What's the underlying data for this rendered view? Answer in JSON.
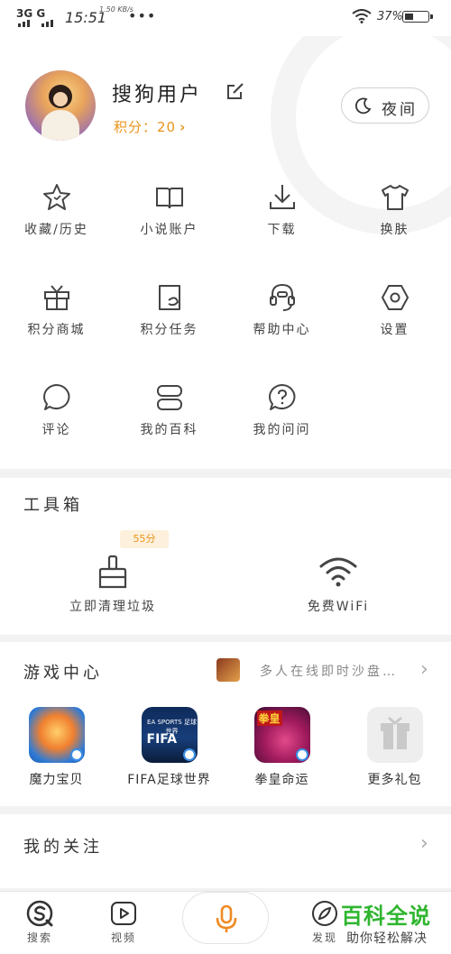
{
  "status_bar": {
    "signal": "3G G",
    "time": "15:51",
    "net_speed": "1.50 KB/s",
    "more": "•••",
    "battery_percent": "37%",
    "battery_level": 0.37
  },
  "profile": {
    "username": "搜狗用户",
    "points_label": "积分：20",
    "night_mode_label": "夜间"
  },
  "grid": [
    {
      "label": "收藏/历史",
      "icon": "star-icon"
    },
    {
      "label": "小说账户",
      "icon": "book-icon"
    },
    {
      "label": "下载",
      "icon": "download-icon"
    },
    {
      "label": "换肤",
      "icon": "tshirt-icon"
    },
    {
      "label": "积分商城",
      "icon": "gift-icon"
    },
    {
      "label": "积分任务",
      "icon": "task-icon"
    },
    {
      "label": "帮助中心",
      "icon": "headset-icon"
    },
    {
      "label": "设置",
      "icon": "settings-icon"
    },
    {
      "label": "评论",
      "icon": "comment-icon"
    },
    {
      "label": "我的百科",
      "icon": "encyclopedia-icon"
    },
    {
      "label": "我的问问",
      "icon": "question-icon"
    }
  ],
  "toolbox": {
    "title": "工具箱",
    "items": [
      {
        "label": "立即清理垃圾",
        "badge": "55分",
        "icon": "broom-icon"
      },
      {
        "label": "免费WiFi",
        "icon": "wifi-icon"
      }
    ]
  },
  "game_center": {
    "title": "游戏中心",
    "promo_text": "多人在线即时沙盘…",
    "games": [
      {
        "label": "魔力宝贝"
      },
      {
        "label": "FIFA足球世界",
        "icon_text": "FIFA",
        "icon_subtext": "EA SPORTS 足球世界"
      },
      {
        "label": "拳皇命运",
        "icon_text": "拳皇"
      },
      {
        "label": "更多礼包"
      }
    ]
  },
  "follow": {
    "title": "我的关注"
  },
  "tabbar": {
    "tabs": [
      {
        "label": "搜索",
        "icon": "sogou-search-icon"
      },
      {
        "label": "视频",
        "icon": "video-icon"
      },
      {
        "label": "发现",
        "icon": "discover-icon"
      }
    ],
    "voice": "microphone-icon"
  },
  "watermark": {
    "title": "百科全说",
    "subtitle": "助你轻松解决"
  },
  "colors": {
    "accent_orange": "#e8941a",
    "mic_orange": "#f08a24",
    "watermark_green": "#2fb52f"
  }
}
